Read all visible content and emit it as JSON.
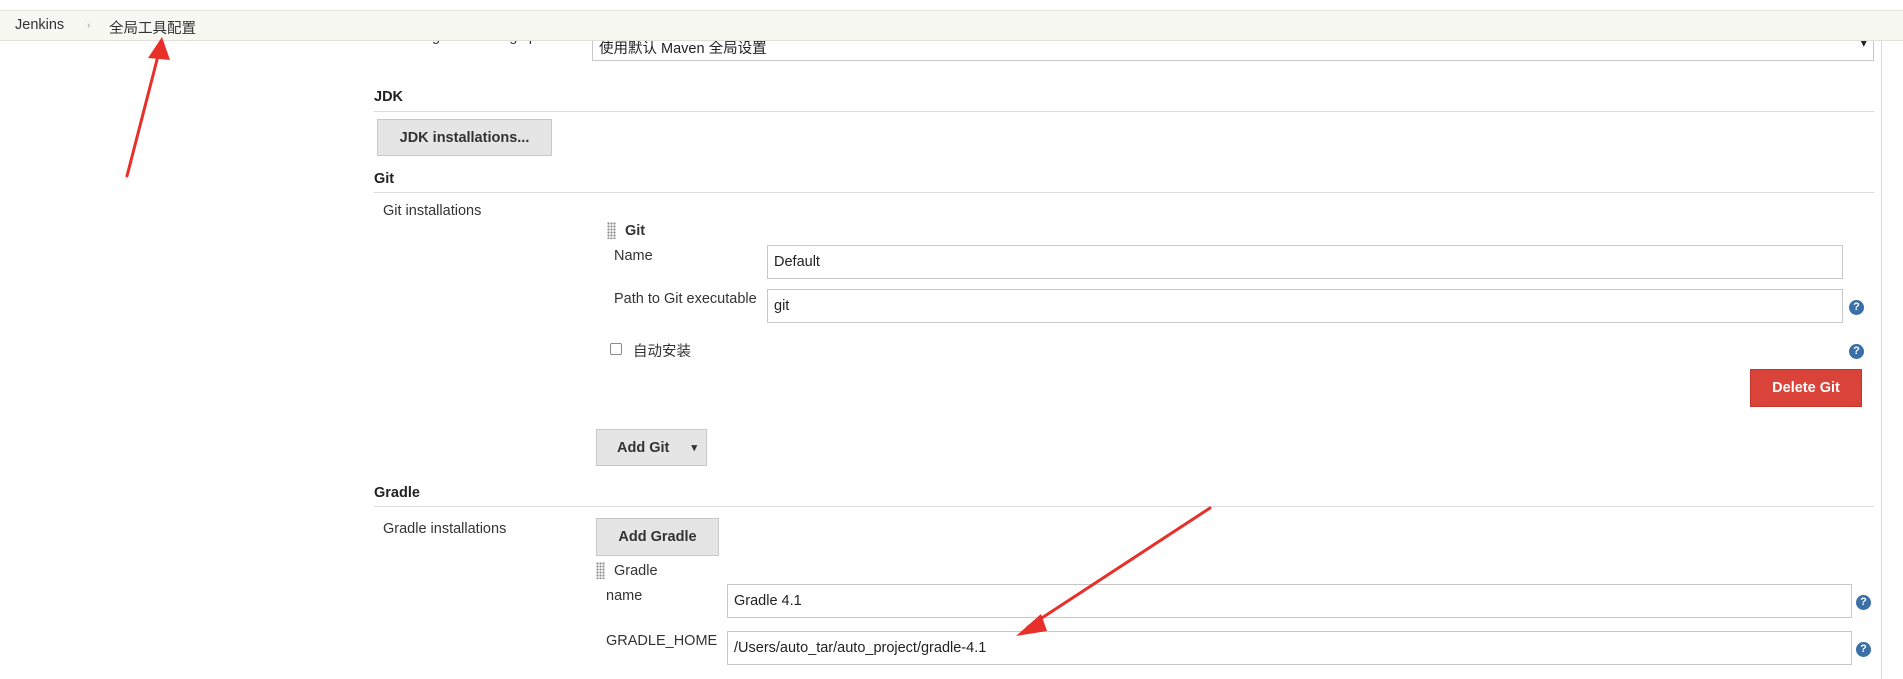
{
  "breadcrumb": {
    "root": "Jenkins",
    "separator": "›",
    "current": "全局工具配置"
  },
  "maven": {
    "settings_label": "Default global settings provider",
    "settings_value": "使用默认 Maven 全局设置",
    "dropdown_icon": "▾"
  },
  "jdk": {
    "title": "JDK",
    "button_label": "JDK installations..."
  },
  "git": {
    "title": "Git",
    "installations_label": "Git installations",
    "item_header": "Git",
    "name_label": "Name",
    "name_value": "Default",
    "path_label": "Path to Git executable",
    "path_value": "git",
    "auto_install_label": "自动安装",
    "delete_button": "Delete Git",
    "add_button": "Add Git",
    "add_caret": "▾"
  },
  "gradle": {
    "title": "Gradle",
    "installations_label": "Gradle installations",
    "add_button": "Add Gradle",
    "item_header": "Gradle",
    "name_label": "name",
    "name_value": "Gradle 4.1",
    "home_label": "GRADLE_HOME",
    "home_value": "/Users/auto_tar/auto_project/gradle-4.1"
  },
  "help_glyph": "?",
  "colors": {
    "breadcrumb_bg": "#f6f8f1",
    "danger": "#d9433a",
    "help": "#3b6fa8",
    "annotation_arrow": "#e8302a"
  }
}
